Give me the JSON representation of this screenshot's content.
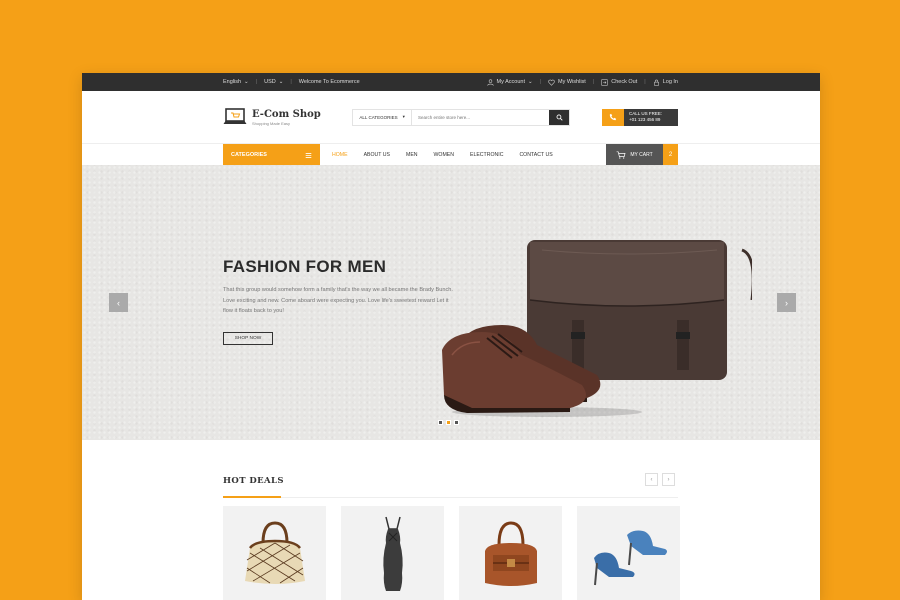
{
  "topbar": {
    "language": "English",
    "currency": "USD",
    "welcome": "Welcome To Ecommerce",
    "account": "My Account",
    "wishlist": "My Wishlist",
    "checkout": "Check Out",
    "login": "Log In"
  },
  "header": {
    "logo_name": "E-Com Shop",
    "logo_tagline": "Shopping Made Easy",
    "search_category": "ALL CATEGORIES",
    "search_placeholder": "Search entire store here...",
    "call_label": "CALL US FREE:",
    "call_number": "+01 123 456 89"
  },
  "nav": {
    "categories": "CATEGORIES",
    "items": [
      {
        "label": "HOME",
        "active": true
      },
      {
        "label": "ABOUT US"
      },
      {
        "label": "MEN"
      },
      {
        "label": "WOMEN"
      },
      {
        "label": "ELECTRONIC"
      },
      {
        "label": "CONTACT US"
      }
    ],
    "cart_label": "MY CART",
    "cart_count": "2"
  },
  "hero": {
    "title": "FASHION FOR MEN",
    "text": "That this group would somehow form a family that's the way we all became the Brady Bunch. Love exciting and new. Come aboard were expecting you. Love life's sweetest reward Let it flow it floats back to you!",
    "button": "SHOP NOW",
    "prev": "‹",
    "next": "›",
    "active_slide": 2
  },
  "deals": {
    "title": "HOT DEALS",
    "prev": "‹",
    "next": "›",
    "products": [
      "handbag-icon",
      "dress-icon",
      "leather-bag-icon",
      "heels-icon"
    ]
  },
  "colors": {
    "accent": "#f5a017",
    "dark": "#2f2f2f"
  }
}
